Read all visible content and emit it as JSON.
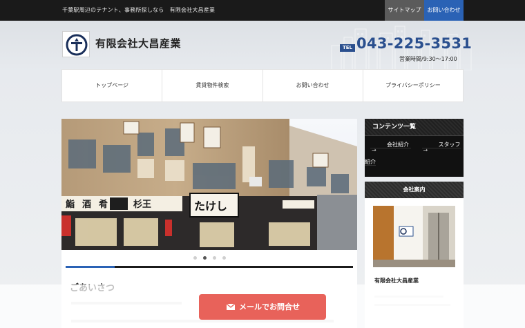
{
  "topbar": {
    "tagline": "千葉駅周辺のテナント、事務所探しなら　有限会社大昌産業",
    "sitemap_label": "サイトマップ",
    "contact_label": "お問い合わせ"
  },
  "header": {
    "company_name": "有限会社大昌産業",
    "tel_badge": "TEL",
    "tel_number": "043-225-3531",
    "hours": "営業時間/9:30〜17:00"
  },
  "nav": {
    "items": [
      {
        "label": "トップページ"
      },
      {
        "label": "賃貸物件検索"
      },
      {
        "label": "お問い合わせ"
      },
      {
        "label": "プライバシーポリシー"
      }
    ]
  },
  "main": {
    "slider": {
      "slide_count": 4,
      "active_slide": 2,
      "progress_fraction": 0.17,
      "signs": [
        "たけし",
        "杉王",
        "鮨",
        "酒",
        "肴"
      ]
    },
    "greeting_title": "ごあいさつ"
  },
  "sidebar": {
    "contents_heading": "コンテンツ一覧",
    "links": [
      {
        "label": "会社紹介"
      },
      {
        "label": "スタッフ紹介"
      }
    ],
    "about_heading": "会社案内",
    "about_caption": "有限会社大昌産業"
  },
  "cta": {
    "mail_label": "メールでお問合せ"
  },
  "colors": {
    "accent_blue": "#2a62b5",
    "tel_blue": "#2a4f8e",
    "cta_red": "#e8625a",
    "topbar_bg": "#1a1a1a"
  }
}
